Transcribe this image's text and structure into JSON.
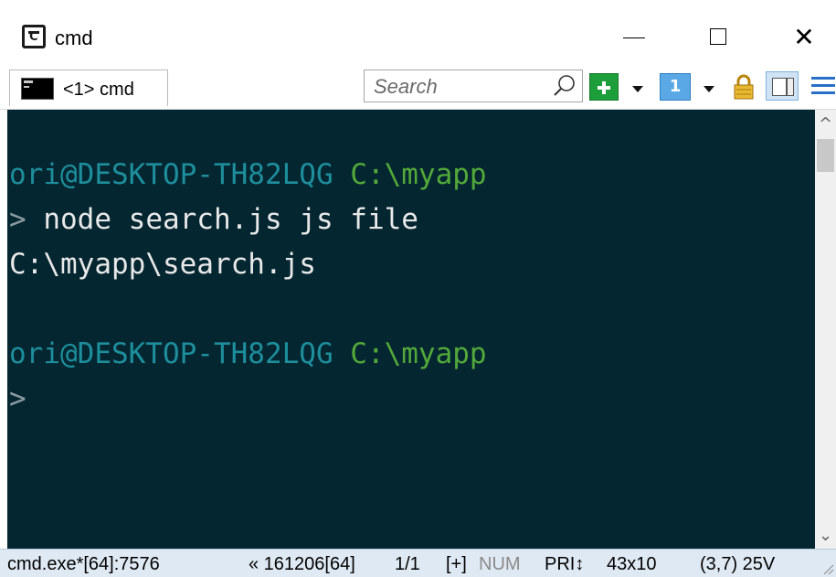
{
  "window": {
    "title": "cmd",
    "controls": {
      "minimize_icon": "minimize-icon",
      "maximize_icon": "maximize-icon",
      "close_icon": "close-icon",
      "close_glyph": "✕"
    }
  },
  "toolbar": {
    "tab_label": "<1> cmd",
    "search_placeholder": "Search",
    "console_number": "1"
  },
  "terminal": {
    "lines": [
      {
        "user": "ori@DESKTOP-TH82LQG",
        "path": "C:\\myapp"
      },
      {
        "prompt": ">",
        "command": " node search.js js file"
      },
      {
        "output": "C:\\myapp\\search.js"
      },
      {
        "blank": ""
      },
      {
        "user": "ori@DESKTOP-TH82LQG",
        "path": "C:\\myapp"
      },
      {
        "prompt": ">"
      }
    ],
    "colors": {
      "background": "#032630",
      "user": "#1e8e9c",
      "path": "#53a83a",
      "text": "#e8e8e8"
    }
  },
  "scrollbar": {
    "up_glyph": "^",
    "down_glyph": "⌄"
  },
  "statusbar": {
    "process": "cmd.exe*[64]:7576",
    "build": "« 161206[64]",
    "console_index": "1/1",
    "plus": "[+]",
    "num": "NUM",
    "pri": "PRI↕",
    "size": "43x10",
    "cursor": "(3,7) 25V"
  }
}
